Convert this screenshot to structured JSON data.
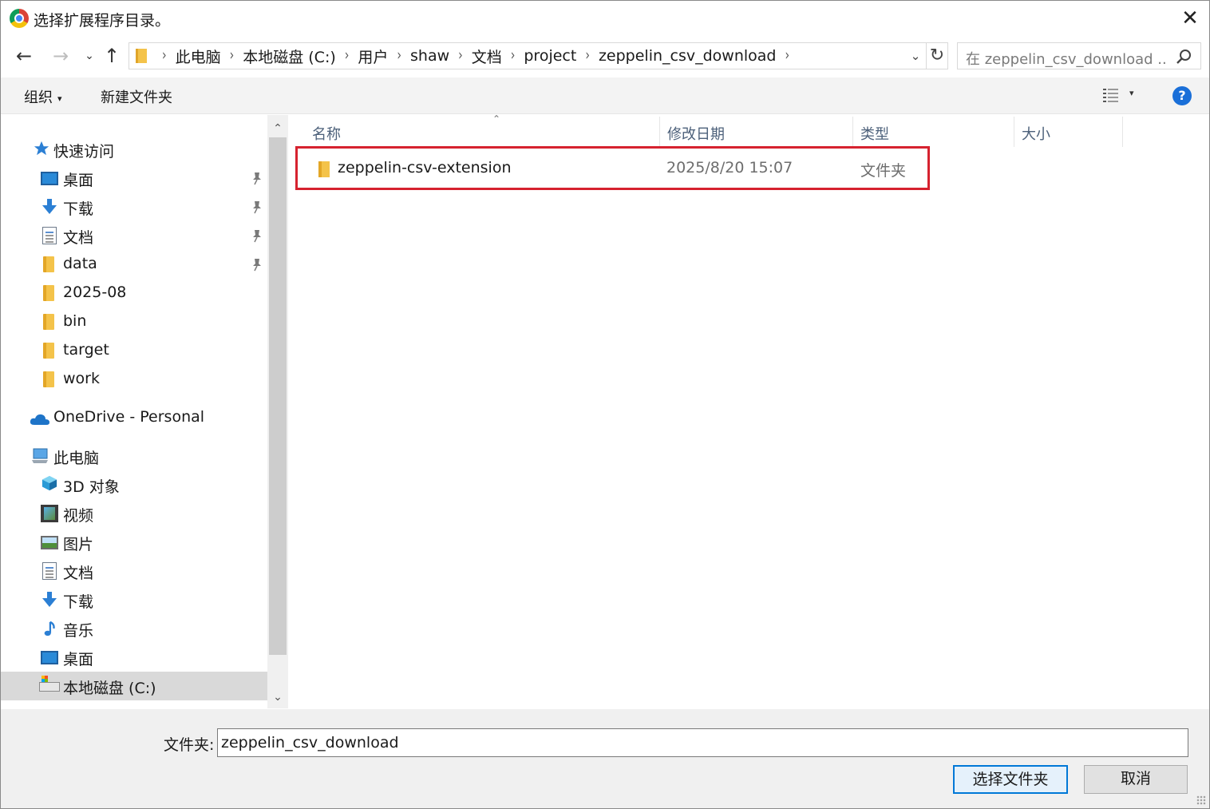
{
  "window": {
    "title": "选择扩展程序目录。",
    "close_glyph": "✕"
  },
  "nav": {
    "back_glyph": "←",
    "forward_glyph": "→",
    "recent_glyph": "⌄",
    "up_glyph": "↑"
  },
  "address": {
    "crumbs": [
      "此电脑",
      "本地磁盘 (C:)",
      "用户",
      "shaw",
      "文档",
      "project",
      "zeppelin_csv_download"
    ],
    "separator": "›",
    "dropdown_glyph": "⌄",
    "refresh_glyph": "↻"
  },
  "search": {
    "placeholder": "在 zeppelin_csv_download ..."
  },
  "toolbar": {
    "organize": "组织",
    "organize_caret": "▾",
    "new_folder": "新建文件夹",
    "view_caret": "▾",
    "help": "?"
  },
  "sidebar": {
    "quick_access": "快速访问",
    "quick_items": [
      {
        "label": "桌面",
        "icon": "desktop-icon",
        "pinned": true
      },
      {
        "label": "下载",
        "icon": "download-icon",
        "pinned": true
      },
      {
        "label": "文档",
        "icon": "document-icon",
        "pinned": true
      },
      {
        "label": "data",
        "icon": "folder-icon",
        "pinned": true
      },
      {
        "label": "2025-08",
        "icon": "folder-icon",
        "pinned": false
      },
      {
        "label": "bin",
        "icon": "folder-icon",
        "pinned": false
      },
      {
        "label": "target",
        "icon": "folder-icon",
        "pinned": false
      },
      {
        "label": "work",
        "icon": "folder-icon",
        "pinned": false
      }
    ],
    "onedrive": "OneDrive - Personal",
    "this_pc": "此电脑",
    "pc_items": [
      {
        "label": "3D 对象",
        "icon": "3d-objects-icon"
      },
      {
        "label": "视频",
        "icon": "video-icon"
      },
      {
        "label": "图片",
        "icon": "pictures-icon"
      },
      {
        "label": "文档",
        "icon": "document-icon"
      },
      {
        "label": "下载",
        "icon": "download-icon"
      },
      {
        "label": "音乐",
        "icon": "music-icon"
      },
      {
        "label": "桌面",
        "icon": "desktop-icon"
      },
      {
        "label": "本地磁盘 (C:)",
        "icon": "drive-icon",
        "selected": true
      }
    ],
    "scroll_up": "⌃",
    "scroll_down": "⌄"
  },
  "filelist": {
    "columns": [
      "名称",
      "修改日期",
      "类型",
      "大小"
    ],
    "sort_glyph": "⌃",
    "rows": [
      {
        "name": "zeppelin-csv-extension",
        "modified": "2025/8/20 15:07",
        "type": "文件夹",
        "size": ""
      }
    ],
    "highlight_color": "#d6222f"
  },
  "bottom": {
    "folder_label": "文件夹:",
    "folder_value": "zeppelin_csv_download",
    "select_button": "选择文件夹",
    "cancel_button": "取消"
  },
  "colors": {
    "accent": "#0078d7",
    "toolbar_bg": "#f3f3f3",
    "selected_bg": "#d9d9d9",
    "help_blue": "#1a6fd8"
  }
}
